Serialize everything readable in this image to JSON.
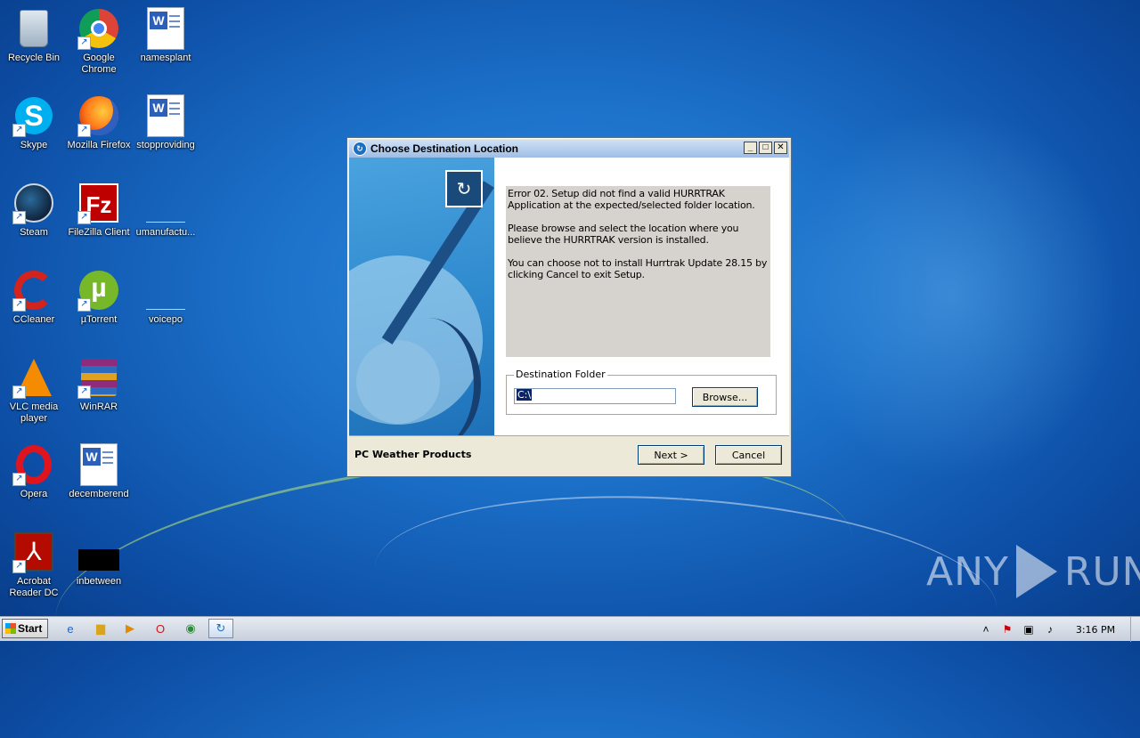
{
  "desktop": {
    "icons": [
      {
        "label": "Recycle Bin",
        "icon": "recycle-bin-icon"
      },
      {
        "label": "Google Chrome",
        "icon": "chrome-icon"
      },
      {
        "label": "namesplant",
        "icon": "word-document-icon"
      },
      {
        "label": "Skype",
        "icon": "skype-icon"
      },
      {
        "label": "Mozilla Firefox",
        "icon": "firefox-icon"
      },
      {
        "label": "stopproviding",
        "icon": "word-document-icon"
      },
      {
        "label": "Steam",
        "icon": "steam-icon"
      },
      {
        "label": "FileZilla Client",
        "icon": "filezilla-icon"
      },
      {
        "label": "umanufactu...",
        "icon": "blank-file-icon"
      },
      {
        "label": "CCleaner",
        "icon": "ccleaner-icon"
      },
      {
        "label": "µTorrent",
        "icon": "utorrent-icon"
      },
      {
        "label": "voicepo",
        "icon": "blank-file-icon"
      },
      {
        "label": "VLC media player",
        "icon": "vlc-icon"
      },
      {
        "label": "WinRAR",
        "icon": "winrar-icon"
      },
      {
        "label": "Opera",
        "icon": "opera-icon"
      },
      {
        "label": "decemberend",
        "icon": "word-document-icon"
      },
      {
        "label": "Acrobat Reader DC",
        "icon": "acrobat-icon"
      },
      {
        "label": "inbetween",
        "icon": "black-file-icon"
      }
    ]
  },
  "dialog": {
    "title": "Choose Destination Location",
    "message": {
      "p1": "Error 02.  Setup did not find a valid HURRTRAK Application at the expected/selected folder location.",
      "p2": "Please browse and select the location where you believe the HURRTRAK version is installed.",
      "p3": "You can choose not to install Hurrtrak Update 28.15 by clicking Cancel to exit Setup."
    },
    "destination_group_label": "Destination Folder",
    "destination_value": "C:\\",
    "browse_label": "Browse...",
    "footer_company": "PC Weather Products",
    "next_label": "Next >",
    "cancel_label": "Cancel"
  },
  "taskbar": {
    "start_label": "Start",
    "clock": "3:16 PM"
  },
  "watermark": {
    "left": "ANY",
    "right": "RUN"
  }
}
